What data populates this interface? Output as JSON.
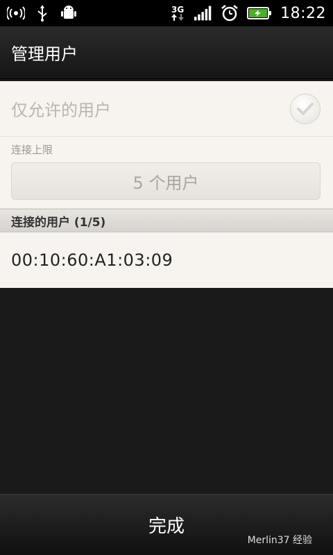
{
  "status_bar": {
    "network_badge": "3G",
    "time": "18:22"
  },
  "header": {
    "title": "管理用户"
  },
  "settings": {
    "allow_only_label": "仅允许的用户",
    "limit_label": "连接上限",
    "limit_value": "5 个用户"
  },
  "connected": {
    "header": "连接的用户 (1/5)",
    "devices": [
      "00:10:60:A1:03:09"
    ]
  },
  "footer": {
    "done_label": "完成"
  },
  "watermark": {
    "text": "Merlin37 经验"
  }
}
